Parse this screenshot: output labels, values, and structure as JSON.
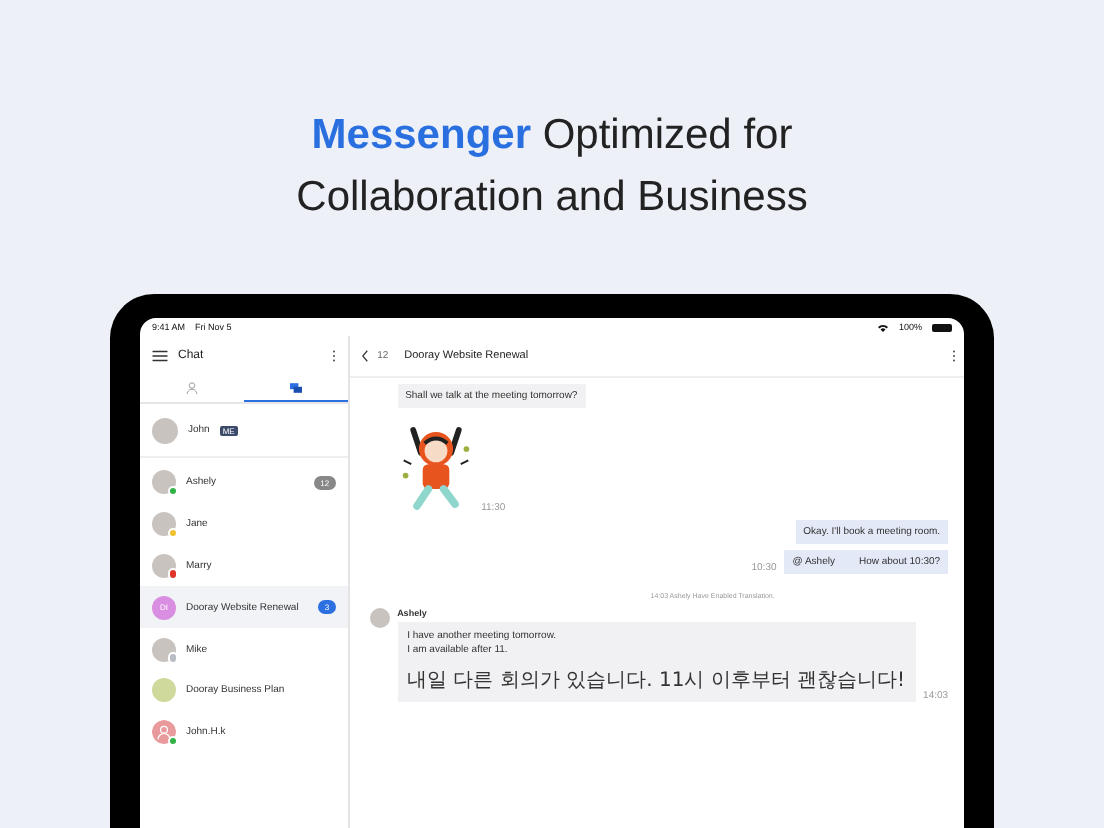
{
  "headline": "**Messenger** Optimized for Collaboration and Business",
  "status_bar": {
    "time": "9:41 AM",
    "date": "Fri Nov 5",
    "battery": "100%"
  },
  "sidebar": {
    "title": "Chat",
    "tabs": [
      {
        "kind": "person",
        "selected": false
      },
      {
        "kind": "chat",
        "selected": true
      }
    ],
    "me": {
      "name": "John",
      "badge": "ME"
    },
    "chats": [
      {
        "name": "Ashely",
        "avatar": {
          "kind": "photo"
        },
        "color": "#2fb344",
        "unread": "12",
        "selected": false
      },
      {
        "name": "Jane",
        "avatar": {
          "kind": "photo"
        },
        "color": "#f2c12e",
        "selected": false
      },
      {
        "name": "Marry",
        "avatar": {
          "kind": "photo"
        },
        "color": "#e0352b",
        "selected": false
      },
      {
        "name": "Dooray Website Renewal",
        "avatar": {
          "kind": "initials",
          "initials": "DI",
          "color": "#d98ee2"
        },
        "unread": "3",
        "selected": true
      },
      {
        "name": "Mike",
        "avatar": {
          "kind": "photo"
        },
        "color": "#b8bcc4",
        "selected": false
      },
      {
        "name": "Dooray Business Plan",
        "avatar": {
          "kind": "initials",
          "color": "#cfd99b"
        },
        "selected": false
      },
      {
        "name": "John.H.k",
        "avatar": {
          "kind": "person",
          "color": "#e89a9c"
        },
        "color": "#2fb344",
        "selected": false
      }
    ]
  },
  "chat": {
    "back_count": "12",
    "title": "Dooray Website Renewal",
    "messages": [
      {
        "kind": "in",
        "text": "Shall we talk at the meeting tomorrow?"
      },
      {
        "kind": "sticker",
        "time": "11:30"
      },
      {
        "kind": "out",
        "text": "Okay. I'll book a meeting room."
      },
      {
        "kind": "out_mention",
        "mention": "@ Ashely",
        "text": "How about 10:30?",
        "time": "10:30"
      },
      {
        "kind": "notice",
        "text": "14:03 Ashely Have Enabled Translation."
      },
      {
        "kind": "in_named",
        "sender": "Ashely",
        "text": "I have another meeting tomorrow.\nI am available after 11.",
        "translation": "내일 다른 회의가 있습니다. 11시 이후부터 괜찮습니다!",
        "time": "14:03"
      }
    ]
  }
}
